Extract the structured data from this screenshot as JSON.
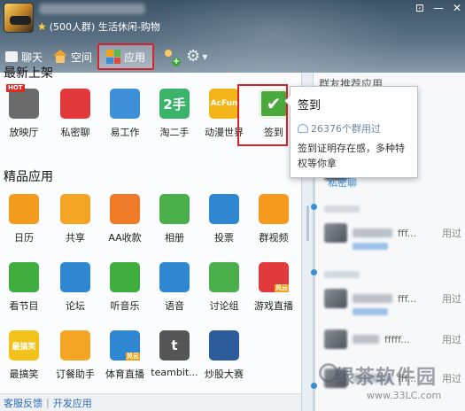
{
  "header": {
    "group_name": "(500人群) 生活休闲-购物",
    "window_controls": [
      "⊡",
      "—",
      "✕"
    ],
    "nav": [
      {
        "label": "聊天",
        "icon": "chat-icon"
      },
      {
        "label": "空间",
        "icon": "home-icon"
      },
      {
        "label": "应用",
        "icon": "apps-icon",
        "active": true
      }
    ]
  },
  "sections": {
    "recent_title": "最新上架",
    "featured_title": "精品应用"
  },
  "recent_apps": [
    {
      "label": "放映厅",
      "icon": "cinema-icon",
      "badge": "HOT",
      "color": "#6b6b6b"
    },
    {
      "label": "私密聊",
      "icon": "private-chat-icon",
      "color": "#e23a3a"
    },
    {
      "label": "易工作",
      "icon": "work-icon",
      "color": "#3d8fd8"
    },
    {
      "label": "淘二手",
      "icon": "secondhand-icon",
      "glyph": "2手",
      "color": "#3bb36a"
    },
    {
      "label": "动漫世界",
      "icon": "acfun-icon",
      "glyph": "AcFun",
      "color": "#f3b51a"
    },
    {
      "label": "签到",
      "icon": "checkin-icon",
      "color": "#4aa83c"
    }
  ],
  "featured_apps": [
    {
      "label": "日历",
      "icon": "calendar-icon",
      "color": "#f39c1e"
    },
    {
      "label": "共享",
      "icon": "folder-icon",
      "color": "#f5a524"
    },
    {
      "label": "AA收款",
      "icon": "aa-payment-icon",
      "color": "#f07c2a"
    },
    {
      "label": "相册",
      "icon": "album-icon",
      "color": "#4bb04c"
    },
    {
      "label": "投票",
      "icon": "vote-icon",
      "color": "#2f86d1"
    },
    {
      "label": "群视频",
      "icon": "video-icon",
      "color": "#f59a1c"
    },
    {
      "label": "看节目",
      "icon": "film-icon",
      "color": "#3fae3f"
    },
    {
      "label": "论坛",
      "icon": "forum-icon",
      "color": "#2f86d1"
    },
    {
      "label": "听音乐",
      "icon": "music-icon",
      "color": "#3fae3f"
    },
    {
      "label": "语音",
      "icon": "voice-icon",
      "color": "#2f86d1"
    },
    {
      "label": "讨论组",
      "icon": "discussion-icon",
      "color": "#4bb04c"
    },
    {
      "label": "游戏直播",
      "icon": "game-live-icon",
      "badge": "风云",
      "color": "#e23a3a"
    },
    {
      "label": "最搞笑",
      "icon": "funny-icon",
      "glyph": "最搞笑",
      "color": "#f2c21a"
    },
    {
      "label": "订餐助手",
      "icon": "food-icon",
      "color": "#f5a524"
    },
    {
      "label": "体育直播",
      "icon": "sports-icon",
      "badge": "风云",
      "color": "#2f86d1"
    },
    {
      "label": "teambit...",
      "icon": "teambition-icon",
      "glyph": "t",
      "color": "#555555"
    },
    {
      "label": "炒股大赛",
      "icon": "stock-icon",
      "color": "#2c5c9c"
    }
  ],
  "tooltip": {
    "title": "签到",
    "count": "26376个群用过",
    "description": "签到证明存在感，多种特权等你拿"
  },
  "right_panel": {
    "header": "群友推荐应用",
    "feed": [
      {
        "link": "私密聊"
      },
      {
        "name": "fff...",
        "used": "用过"
      },
      {
        "name": "fff...",
        "used": "用过"
      },
      {
        "name": "fffff...",
        "used": "用过"
      },
      {
        "name": "fff...",
        "used": "用过"
      }
    ]
  },
  "footer": {
    "feedback": "客服反馈",
    "separator": "|",
    "develop": "开发应用"
  },
  "watermark": {
    "title": "绿茶软件园",
    "url": "www.33LC.com"
  }
}
